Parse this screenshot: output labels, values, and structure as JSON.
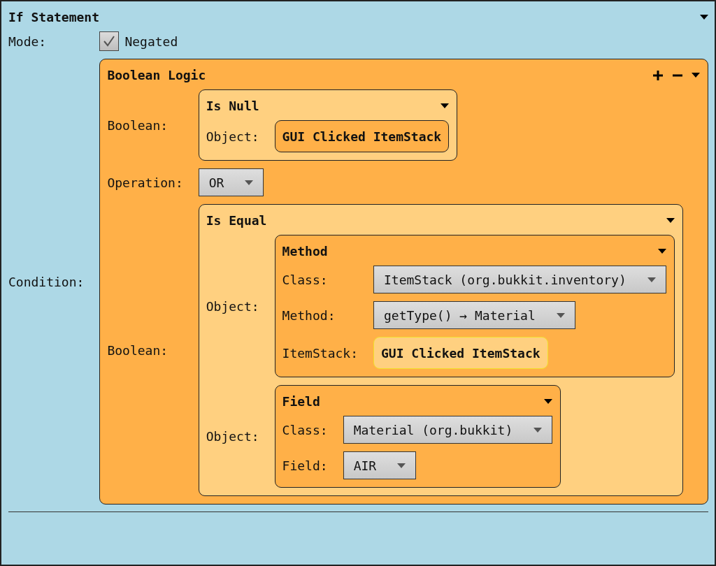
{
  "statement": {
    "title": "If Statement",
    "rows": [
      {
        "label": "Mode:",
        "value": {
          "kind": "checkbox",
          "label": "Negated",
          "checked": true
        }
      },
      {
        "label": "Condition:",
        "value": {
          "kind": "block",
          "title": "Boolean Logic",
          "list_controls": true,
          "rows": [
            {
              "label": "Boolean:",
              "value": {
                "kind": "block",
                "title": "Is Null",
                "rows": [
                  {
                    "label": "Object:",
                    "value": {
                      "kind": "chip",
                      "text": "GUI Clicked ItemStack",
                      "highlighted": false
                    }
                  }
                ]
              }
            },
            {
              "label": "Operation:",
              "value": {
                "kind": "dropdown",
                "value": "OR"
              }
            },
            {
              "label": "Boolean:",
              "value": {
                "kind": "block",
                "title": "Is Equal",
                "rows": [
                  {
                    "label": "Object:",
                    "value": {
                      "kind": "block",
                      "title": "Method",
                      "rows": [
                        {
                          "label": "Class:",
                          "value": {
                            "kind": "dropdown",
                            "value": "ItemStack (org.bukkit.inventory)"
                          }
                        },
                        {
                          "label": "Method:",
                          "value": {
                            "kind": "dropdown",
                            "value": "getType() → Material"
                          }
                        },
                        {
                          "label": "ItemStack:",
                          "value": {
                            "kind": "chip",
                            "text": "GUI Clicked ItemStack",
                            "highlighted": true
                          }
                        }
                      ]
                    }
                  },
                  {
                    "label": "Object:",
                    "value": {
                      "kind": "block",
                      "title": "Field",
                      "rows": [
                        {
                          "label": "Class:",
                          "value": {
                            "kind": "dropdown",
                            "value": "Material (org.bukkit)"
                          }
                        },
                        {
                          "label": "Field:",
                          "value": {
                            "kind": "dropdown",
                            "value": "AIR"
                          }
                        }
                      ]
                    }
                  }
                ]
              }
            }
          ]
        }
      }
    ]
  }
}
